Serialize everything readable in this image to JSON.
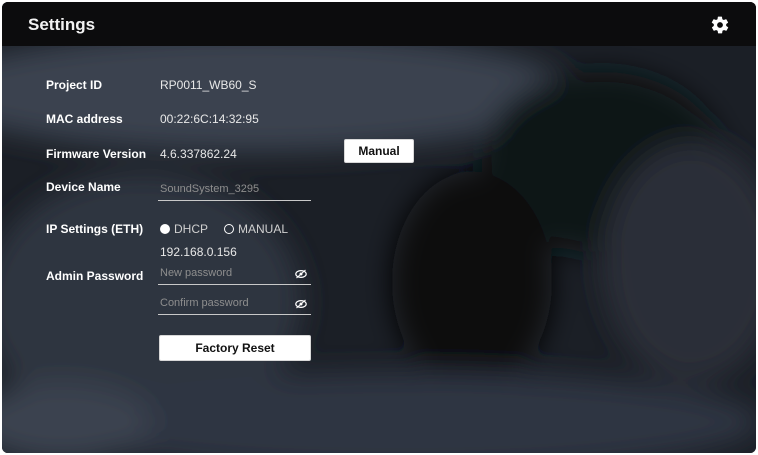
{
  "header": {
    "title": "Settings",
    "settings_icon": "gear-icon"
  },
  "rows": {
    "project_id": {
      "label": "Project ID",
      "value": "RP0011_WB60_S"
    },
    "mac_address": {
      "label": "MAC address",
      "value": "00:22:6C:14:32:95"
    },
    "firmware": {
      "label": "Firmware Version",
      "value": "4.6.337862.24",
      "button": "Manual"
    },
    "device_name": {
      "label": "Device Name",
      "placeholder": "SoundSystem_3295"
    },
    "ip_settings": {
      "label": "IP Settings (ETH)",
      "options": [
        "DHCP",
        "MANUAL"
      ],
      "selected": "DHCP",
      "ip": "192.168.0.156"
    },
    "admin_password": {
      "label": "Admin Password",
      "new_placeholder": "New password",
      "confirm_placeholder": "Confirm password",
      "visibility_icon": "eye-icon"
    }
  },
  "actions": {
    "factory_reset": "Factory Reset"
  },
  "colors": {
    "header_bg": "#0c0c0d",
    "text": "#ffffff",
    "button_bg": "#ffffff"
  }
}
